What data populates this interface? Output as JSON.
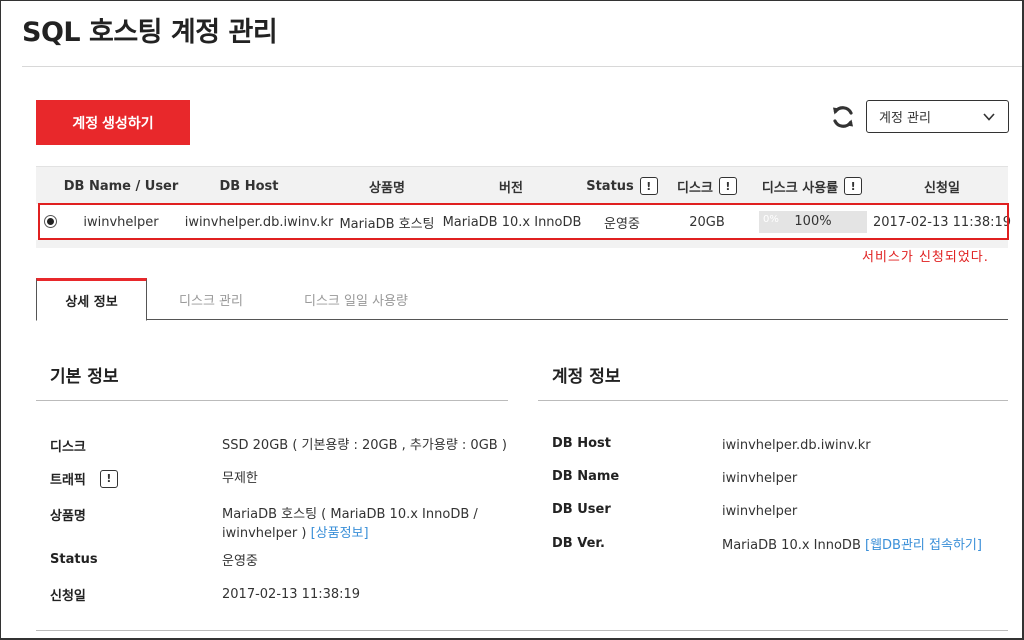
{
  "page": {
    "title": "SQL 호스팅 계정 관리"
  },
  "toolbar": {
    "create_label": "계정 생성하기",
    "refresh_icon": "refresh-icon",
    "select_value": "계정 관리"
  },
  "table": {
    "headers": {
      "db_name_user": "DB Name / User",
      "db_host": "DB Host",
      "product": "상품명",
      "version": "버전",
      "status": "Status",
      "disk": "디스크",
      "disk_usage": "디스크 사용률",
      "applied": "신청일"
    },
    "info_badge": "!",
    "row": {
      "db_name_user": "iwinvhelper",
      "db_host": "iwinvhelper.db.iwinv.kr",
      "product": "MariaDB 호스팅",
      "version": "MariaDB 10.x InnoDB",
      "status": "운영중",
      "disk": "20GB",
      "usage_min_label": "0%",
      "usage_value": "100%",
      "usage_fraction": 1.0,
      "applied": "2017-02-13 11:38:19"
    }
  },
  "annotation": "서비스가 신청되었다.",
  "tabs": [
    {
      "label": "상세 정보"
    },
    {
      "label": "디스크 관리"
    },
    {
      "label": "디스크 일일 사용량"
    }
  ],
  "basic_info": {
    "title": "기본 정보",
    "disk_label": "디스크",
    "disk_value": "SSD 20GB ( 기본용량 : 20GB , 추가용량 : 0GB )",
    "traffic_label": "트래픽",
    "traffic_value": "무제한",
    "product_label": "상품명",
    "product_value_line1": "MariaDB 호스팅 ( MariaDB 10.x InnoDB /",
    "product_value_line2": "iwinvhelper )",
    "product_link": "[상품정보]",
    "status_label": "Status",
    "status_value": "운영중",
    "applied_label": "신청일",
    "applied_value": "2017-02-13 11:38:19"
  },
  "account_info": {
    "title": "계정 정보",
    "host_label": "DB Host",
    "host_value": "iwinvhelper.db.iwinv.kr",
    "name_label": "DB Name",
    "name_value": "iwinvhelper",
    "user_label": "DB User",
    "user_value": "iwinvhelper",
    "ver_label": "DB Ver.",
    "ver_value": "MariaDB 10.x InnoDB",
    "ver_link": "[웹DB관리 접속하기]"
  }
}
